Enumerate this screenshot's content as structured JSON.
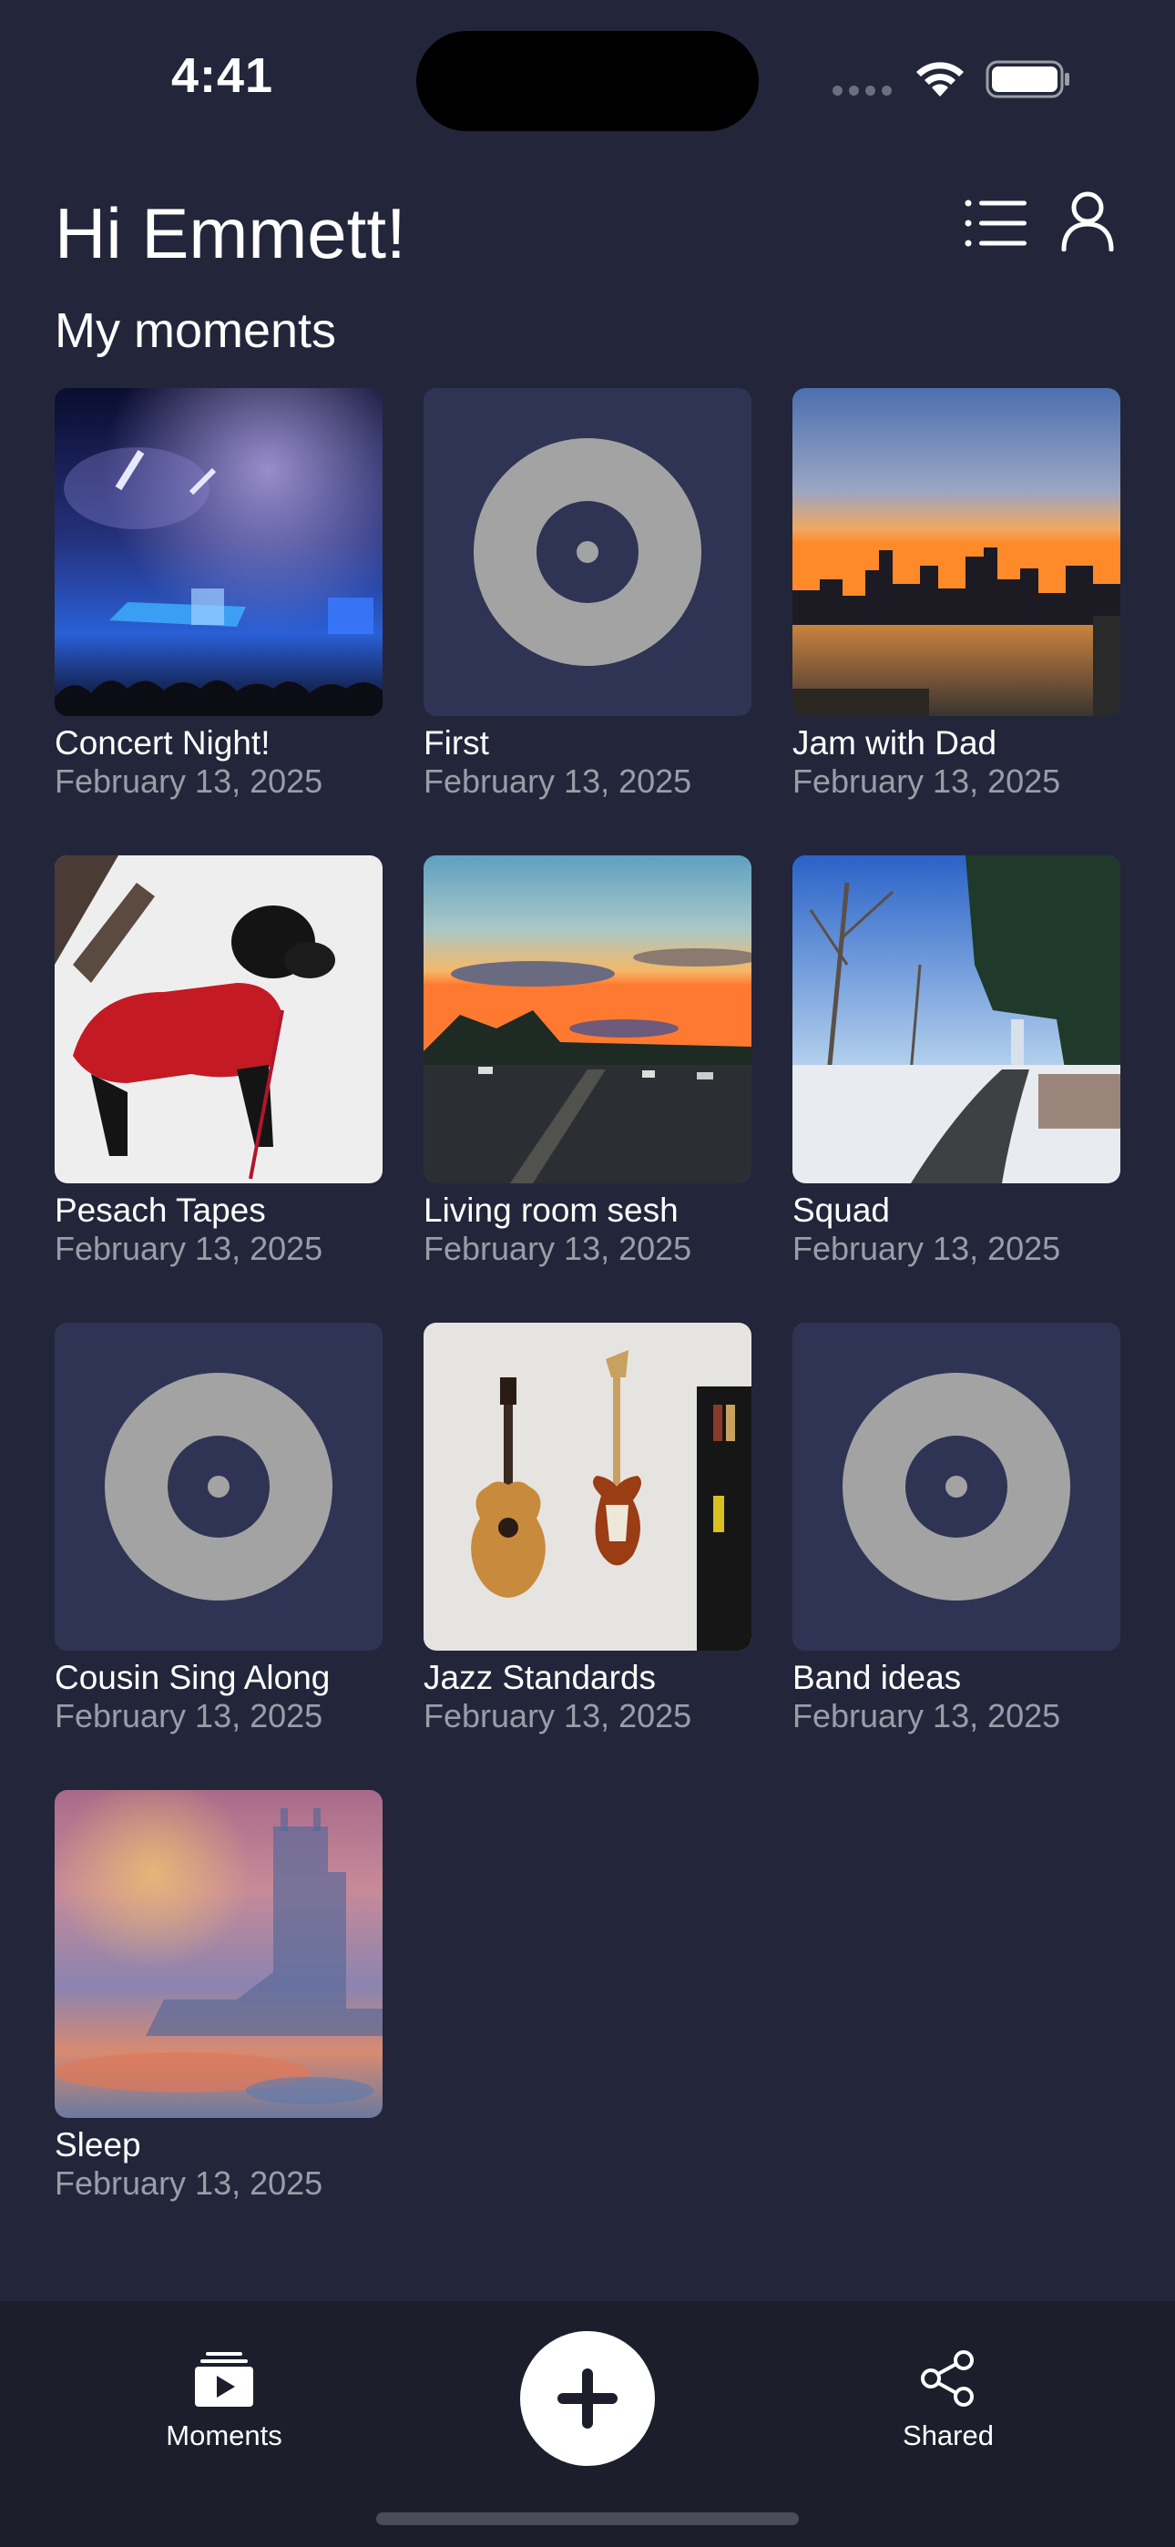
{
  "status_bar": {
    "time": "4:41",
    "wifi_icon": "wifi-icon",
    "battery_icon": "battery-icon"
  },
  "header": {
    "greeting": "Hi Emmett!",
    "list_icon": "list-icon",
    "profile_icon": "profile-icon"
  },
  "section_title": "My moments",
  "moments": [
    {
      "title": "Concert Night!",
      "date": "February 13, 2025",
      "thumbnail": "concert-photo"
    },
    {
      "title": "First",
      "date": "February 13, 2025",
      "thumbnail": "record-placeholder-icon"
    },
    {
      "title": "Jam with Dad",
      "date": "February 13, 2025",
      "thumbnail": "city-sunset-photo"
    },
    {
      "title": "Pesach Tapes",
      "date": "February 13, 2025",
      "thumbnail": "dog-in-snow-photo"
    },
    {
      "title": "Living room sesh",
      "date": "February 13, 2025",
      "thumbnail": "highway-sunset-photo"
    },
    {
      "title": "Squad",
      "date": "February 13, 2025",
      "thumbnail": "snowy-park-photo"
    },
    {
      "title": "Cousin Sing Along",
      "date": "February 13, 2025",
      "thumbnail": "record-placeholder-icon"
    },
    {
      "title": "Jazz Standards",
      "date": "February 13, 2025",
      "thumbnail": "guitars-photo"
    },
    {
      "title": "Band ideas",
      "date": "February 13, 2025",
      "thumbnail": "record-placeholder-icon"
    },
    {
      "title": "Sleep",
      "date": "February 13, 2025",
      "thumbnail": "impressionist-painting"
    }
  ],
  "tabbar": {
    "moments_label": "Moments",
    "moments_icon": "moments-icon",
    "add_icon": "plus-icon",
    "shared_label": "Shared",
    "shared_icon": "share-icon"
  },
  "colors": {
    "background": "#23263a",
    "tile_background": "#2f3454",
    "record_gray": "#a3a3a3",
    "tabbar_background": "#1c1e2c",
    "secondary_text": "#9a9ca8"
  }
}
